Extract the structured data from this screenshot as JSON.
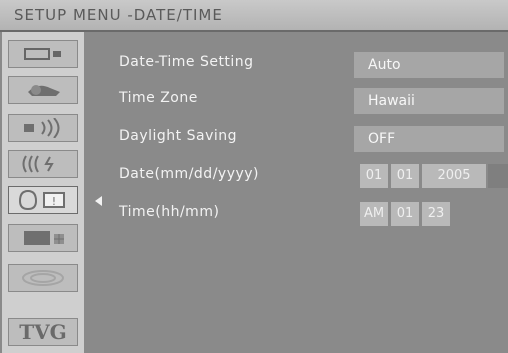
{
  "header": {
    "title": "SETUP MENU -DATE/TIME"
  },
  "sidebar": {
    "items": [
      {
        "icon": "display-icon"
      },
      {
        "icon": "camera-icon"
      },
      {
        "icon": "audio-icon"
      },
      {
        "icon": "signal-icon"
      },
      {
        "icon": "lock-icon",
        "selected": true,
        "badge": "!"
      },
      {
        "icon": "tv-grid-icon"
      },
      {
        "icon": "disc-icon"
      },
      {
        "icon": "tvg-icon",
        "label": "TVG"
      }
    ]
  },
  "settings": [
    {
      "label": "Date-Time Setting",
      "value": "Auto"
    },
    {
      "label": "Time Zone",
      "value": "Hawaii"
    },
    {
      "label": "Daylight Saving",
      "value": "OFF"
    },
    {
      "label": "Date(mm/dd/yyyy)",
      "date": {
        "mm": "01",
        "dd": "01",
        "yyyy": "2005"
      }
    },
    {
      "label": "Time(hh/mm)",
      "time": {
        "ampm": "AM",
        "hh": "01",
        "mm": "23"
      }
    }
  ]
}
